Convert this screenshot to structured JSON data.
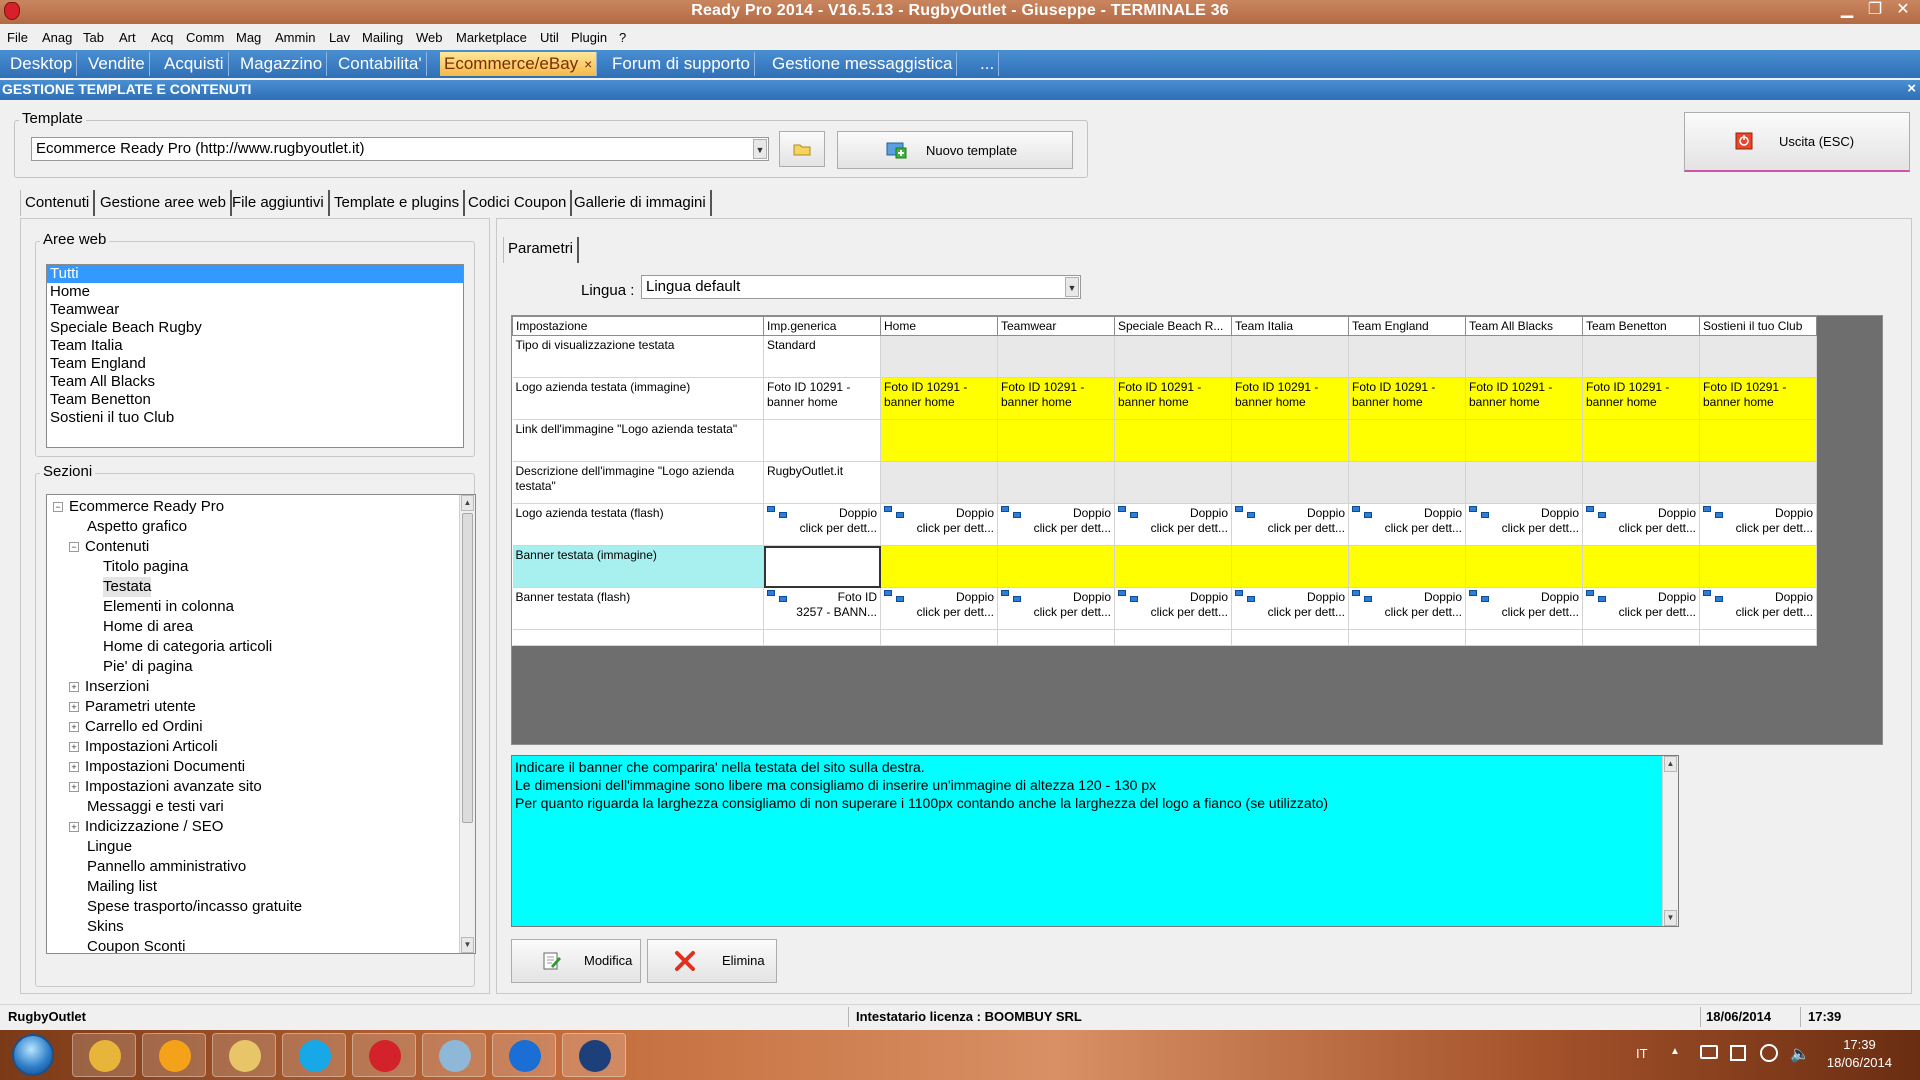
{
  "window": {
    "title": "Ready Pro 2014 - V16.5.13 - RugbyOutlet - Giuseppe - TERMINALE 36"
  },
  "menu": [
    "File",
    "Anag",
    "Tab",
    "Art",
    "Acq",
    "Comm",
    "Mag",
    "Ammin",
    "Lav",
    "Mailing",
    "Web",
    "Marketplace",
    "Util",
    "Plugin",
    "?"
  ],
  "open_tabs": [
    "Desktop",
    "Vendite",
    "Acquisti",
    "Magazzino",
    "Contabilita'",
    "Ecommerce/eBay",
    "Forum di supporto",
    "Gestione messaggistica",
    "..."
  ],
  "active_tab_close": "×",
  "window_header": {
    "title": "GESTIONE TEMPLATE E CONTENUTI",
    "close": "×"
  },
  "template": {
    "group_label": "Template",
    "selected": "Ecommerce Ready Pro (http://www.rugbyoutlet.it)",
    "new_button": "Nuovo template",
    "exit_button": "Uscita (ESC)"
  },
  "main_tabs": [
    "Contenuti",
    "Gestione aree web",
    "File aggiuntivi",
    "Template e plugins",
    "Codici Coupon",
    "Gallerie di immagini"
  ],
  "aree_web": {
    "label": "Aree web",
    "items": [
      "Tutti",
      "Home",
      "Teamwear",
      "Speciale Beach Rugby",
      "Team Italia",
      "Team England",
      "Team All Blacks",
      "Team Benetton",
      "Sostieni il tuo Club"
    ],
    "selected_index": 0
  },
  "sezioni": {
    "label": "Sezioni",
    "nodes": [
      {
        "label": "Ecommerce Ready Pro",
        "level": 0,
        "expander": "−"
      },
      {
        "label": "Aspetto grafico",
        "level": 1,
        "expander": ""
      },
      {
        "label": "Contenuti",
        "level": 1,
        "expander": "−"
      },
      {
        "label": "Titolo pagina",
        "level": 2,
        "expander": ""
      },
      {
        "label": "Testata",
        "level": 2,
        "expander": "",
        "selected": true
      },
      {
        "label": "Elementi in colonna",
        "level": 2,
        "expander": ""
      },
      {
        "label": "Home di area",
        "level": 2,
        "expander": ""
      },
      {
        "label": "Home di categoria articoli",
        "level": 2,
        "expander": ""
      },
      {
        "label": "Pie' di pagina",
        "level": 2,
        "expander": ""
      },
      {
        "label": "Inserzioni",
        "level": 1,
        "expander": "+"
      },
      {
        "label": "Parametri utente",
        "level": 1,
        "expander": "+"
      },
      {
        "label": "Carrello ed Ordini",
        "level": 1,
        "expander": "+"
      },
      {
        "label": "Impostazioni Articoli",
        "level": 1,
        "expander": "+"
      },
      {
        "label": "Impostazioni Documenti",
        "level": 1,
        "expander": "+"
      },
      {
        "label": "Impostazioni avanzate sito",
        "level": 1,
        "expander": "+"
      },
      {
        "label": "Messaggi e testi vari",
        "level": 1,
        "expander": ""
      },
      {
        "label": "Indicizzazione / SEO",
        "level": 1,
        "expander": "+"
      },
      {
        "label": "Lingue",
        "level": 1,
        "expander": ""
      },
      {
        "label": "Pannello amministrativo",
        "level": 1,
        "expander": ""
      },
      {
        "label": "Mailing list",
        "level": 1,
        "expander": ""
      },
      {
        "label": "Spese trasporto/incasso gratuite",
        "level": 1,
        "expander": ""
      },
      {
        "label": "Skins",
        "level": 1,
        "expander": ""
      },
      {
        "label": "Coupon Sconti",
        "level": 1,
        "expander": ""
      }
    ]
  },
  "parametri": {
    "tab_label": "Parametri",
    "lingua_label": "Lingua :",
    "lingua_value": "Lingua default"
  },
  "grid": {
    "columns": [
      "Impostazione",
      "Imp.generica",
      "Home",
      "Teamwear",
      "Speciale Beach R...",
      "Team Italia",
      "Team England",
      "Team All Blacks",
      "Team Benetton",
      "Sostieni il tuo Club"
    ],
    "rows": [
      {
        "name": "Tipo di visualizzazione testata",
        "generic": "Standard",
        "kind": "gray",
        "cell": ""
      },
      {
        "name": "Logo azienda testata (immagine)",
        "generic": "Foto ID 10291 - banner home",
        "kind": "yellow",
        "cell": "Foto ID 10291 - banner home"
      },
      {
        "name": "Link dell'immagine \"Logo azienda testata\"",
        "generic": "",
        "kind": "yellow",
        "cell": ""
      },
      {
        "name": "Descrizione dell'immagine \"Logo azienda testata\"",
        "generic": "RugbyOutlet.it",
        "kind": "gray",
        "cell": ""
      },
      {
        "name": "Logo azienda testata (flash)",
        "generic": "flash",
        "kind": "flash",
        "cell": "flash"
      },
      {
        "name": "Banner testata (immagine)",
        "generic": "",
        "kind": "yellow",
        "cell": "",
        "highlight": true
      },
      {
        "name": "Banner testata (flash)",
        "generic": "flashfoto",
        "kind": "flash",
        "cell": "flash"
      }
    ],
    "flash_line1": "Doppio",
    "flash_line2": "click per dett...",
    "flash_foto_line1": "Foto ID",
    "flash_foto_line2": "3257 - BANN..."
  },
  "description": [
    "Indicare il banner che comparira' nella testata del sito sulla destra.",
    "Le dimensioni dell'immagine sono libere ma consigliamo di inserire un'immagine di altezza 120 - 130 px",
    "Per quanto riguarda la larghezza consigliamo di non superare i 1100px contando anche la larghezza del logo a fianco (se utilizzato)"
  ],
  "buttons": {
    "modifica": "Modifica",
    "elimina": "Elimina"
  },
  "statusbar": {
    "company": "RugbyOutlet",
    "license": "Intestatario licenza : BOOMBUY SRL",
    "date": "18/06/2014",
    "time": "17:39"
  },
  "taskbar": {
    "lang": "IT",
    "clock_time": "17:39",
    "clock_date": "18/06/2014",
    "apps": [
      "chrome-icon",
      "outlook-icon",
      "explorer-icon",
      "skype-icon",
      "readypro-icon",
      "notepad-icon",
      "teamviewer-icon",
      "photoshop-icon"
    ],
    "app_colors": [
      "#e7b53a",
      "#f3a21a",
      "#e8c568",
      "#17a8e8",
      "#d3222a",
      "#8fb8d8",
      "#1b6ed3",
      "#1d3f7a"
    ]
  },
  "colors": {
    "tab_bar": "#2e6fb6",
    "active_tab": "#f4b84a",
    "yellow_cell": "#ffff00",
    "desc_bg": "#00ffff",
    "highlight_row": "#a8f0f0",
    "selected_area": "#3399ff"
  }
}
